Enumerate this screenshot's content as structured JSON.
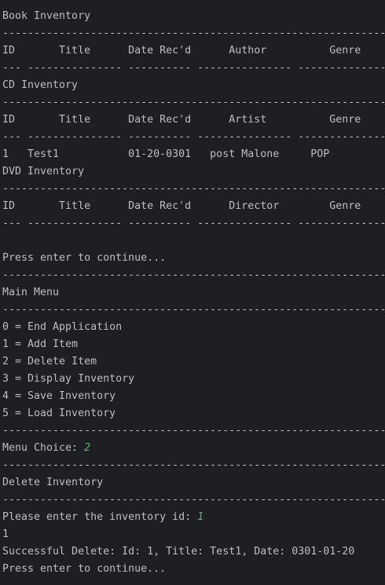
{
  "console": {
    "lines": [
      {
        "text": "-----------------------------------------------------------------"
      },
      {
        "text": "Book Inventory"
      },
      {
        "text": "-----------------------------------------------------------------"
      },
      {
        "text": "ID       Title      Date Rec'd      Author          Genre"
      },
      {
        "text": "--- --------------- ---------- --------------- ---------------"
      },
      {
        "text": "CD Inventory"
      },
      {
        "text": "-----------------------------------------------------------------"
      },
      {
        "text": "ID       Title      Date Rec'd      Artist          Genre"
      },
      {
        "text": "--- --------------- ---------- --------------- ---------------"
      },
      {
        "text": "1   Test1           01-20-0301   post Malone     POP"
      },
      {
        "text": "DVD Inventory"
      },
      {
        "text": "-----------------------------------------------------------------"
      },
      {
        "text": "ID       Title      Date Rec'd      Director        Genre"
      },
      {
        "text": "--- --------------- ---------- --------------- ---------------"
      },
      {
        "text": ""
      },
      {
        "text": "Press enter to continue..."
      },
      {
        "text": "-----------------------------------------------------------------"
      },
      {
        "text": "Main Menu"
      },
      {
        "text": "-----------------------------------------------------------------"
      },
      {
        "text": "0 = End Application"
      },
      {
        "text": "1 = Add Item"
      },
      {
        "text": "2 = Delete Item"
      },
      {
        "text": "3 = Display Inventory"
      },
      {
        "text": "4 = Save Inventory"
      },
      {
        "text": "5 = Load Inventory"
      },
      {
        "text": "-----------------------------------------------------------------"
      },
      {
        "text": "Menu Choice: ",
        "input": "2"
      },
      {
        "text": "-----------------------------------------------------------------"
      },
      {
        "text": "Delete Inventory"
      },
      {
        "text": "-----------------------------------------------------------------"
      },
      {
        "text": "Please enter the inventory id: ",
        "input": "1"
      },
      {
        "text": "1"
      },
      {
        "text": "Successful Delete: Id: 1, Title: Test1, Date: 0301-01-20"
      },
      {
        "text": "Press enter to continue..."
      }
    ]
  },
  "colors": {
    "background": "#1e1f22",
    "text": "#bcbec4",
    "user_input": "#5fb36f"
  }
}
